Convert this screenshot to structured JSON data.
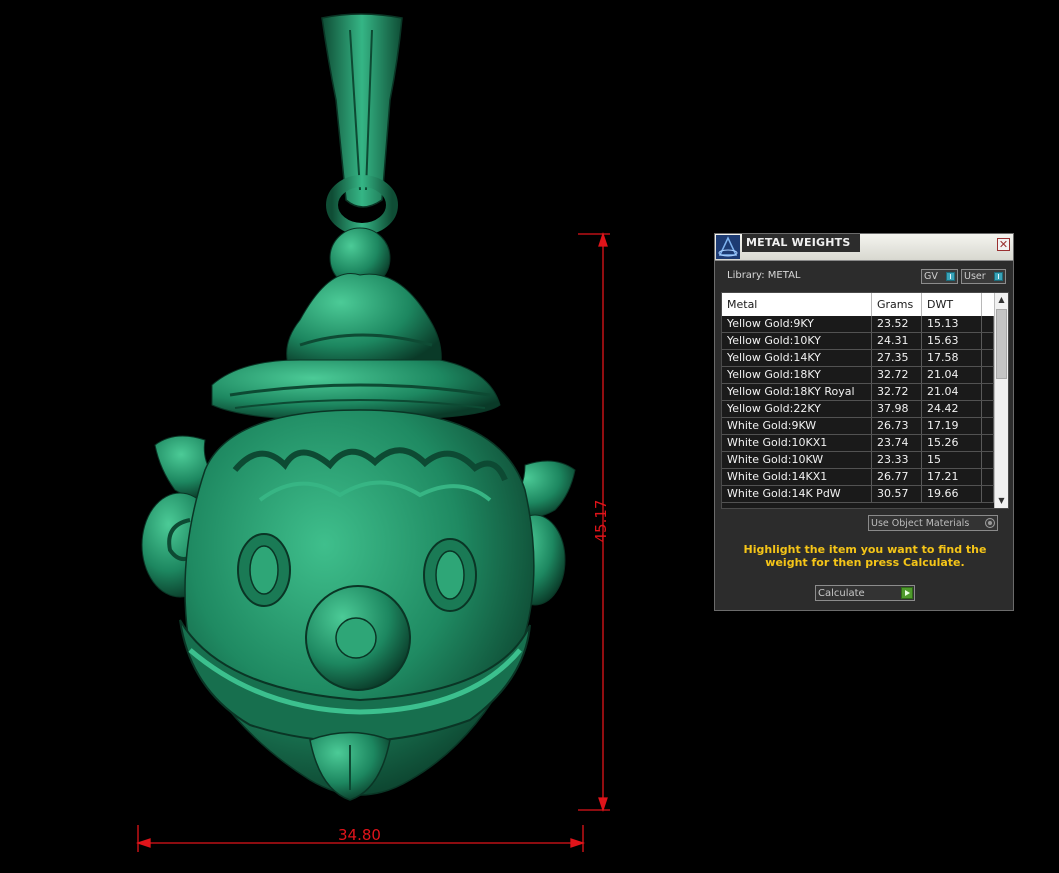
{
  "viewport": {
    "model": "clown-face-pendant",
    "model_color": "#1f8a62",
    "dimension_color": "#e0141a",
    "dim_width_label": "34.80",
    "dim_height_label": "45.17"
  },
  "panel": {
    "title": "METAL WEIGHTS",
    "library_label": "Library: METAL",
    "gv_label": "GV",
    "user_label": "User",
    "columns": [
      "Metal",
      "Grams",
      "DWT"
    ],
    "rows": [
      {
        "metal": "Yellow Gold:9KY",
        "grams": "23.52",
        "dwt": "15.13"
      },
      {
        "metal": "Yellow Gold:10KY",
        "grams": "24.31",
        "dwt": "15.63"
      },
      {
        "metal": "Yellow Gold:14KY",
        "grams": "27.35",
        "dwt": "17.58"
      },
      {
        "metal": "Yellow Gold:18KY",
        "grams": "32.72",
        "dwt": "21.04"
      },
      {
        "metal": "Yellow Gold:18KY Royal",
        "grams": "32.72",
        "dwt": "21.04"
      },
      {
        "metal": "Yellow Gold:22KY",
        "grams": "37.98",
        "dwt": "24.42"
      },
      {
        "metal": "White Gold:9KW",
        "grams": "26.73",
        "dwt": "17.19"
      },
      {
        "metal": "White Gold:10KX1",
        "grams": "23.74",
        "dwt": "15.26"
      },
      {
        "metal": "White Gold:10KW",
        "grams": "23.33",
        "dwt": "15"
      },
      {
        "metal": "White Gold:14KX1",
        "grams": "26.77",
        "dwt": "17.21"
      },
      {
        "metal": "White Gold:14K PdW",
        "grams": "30.57",
        "dwt": "19.66"
      }
    ],
    "use_object_materials_label": "Use Object Materials",
    "instructions": "Highlight the item you want to find the weight for then press Calculate.",
    "calculate_label": "Calculate",
    "accent_color": "#f5c518"
  }
}
